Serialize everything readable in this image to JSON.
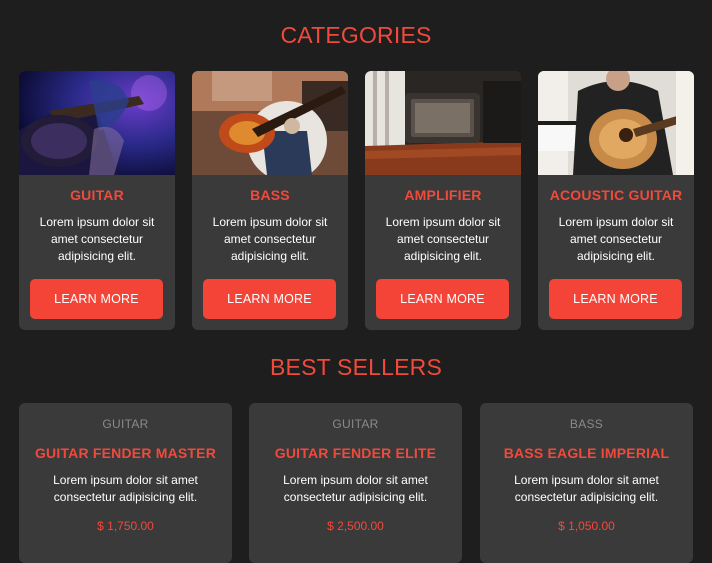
{
  "categories_section": {
    "title": "CATEGORIES",
    "cards": [
      {
        "name": "GUITAR",
        "description": "Lorem ipsum dolor sit amet consectetur adipisicing elit.",
        "button": "LEARN MORE"
      },
      {
        "name": "BASS",
        "description": "Lorem ipsum dolor sit amet consectetur adipisicing elit.",
        "button": "LEARN MORE"
      },
      {
        "name": "AMPLIFIER",
        "description": "Lorem ipsum dolor sit amet consectetur adipisicing elit.",
        "button": "LEARN MORE"
      },
      {
        "name": "ACOUSTIC GUITAR",
        "description": "Lorem ipsum dolor sit amet consectetur adipisicing elit.",
        "button": "LEARN MORE"
      }
    ]
  },
  "best_sellers_section": {
    "title": "BEST SELLERS",
    "products": [
      {
        "category": "GUITAR",
        "name": "GUITAR FENDER MASTER",
        "description": "Lorem ipsum dolor sit amet consectetur adipisicing elit.",
        "price": "$ 1,750.00"
      },
      {
        "category": "GUITAR",
        "name": "GUITAR FENDER ELITE",
        "description": "Lorem ipsum dolor sit amet consectetur adipisicing elit.",
        "price": "$ 2,500.00"
      },
      {
        "category": "BASS",
        "name": "BASS EAGLE IMPERIAL",
        "description": "Lorem ipsum dolor sit amet consectetur adipisicing elit.",
        "price": "$ 1,050.00"
      }
    ]
  },
  "colors": {
    "background": "#1e1e1f",
    "card": "#3a3a3a",
    "accent": "#f04a3c",
    "button": "#f44437"
  }
}
